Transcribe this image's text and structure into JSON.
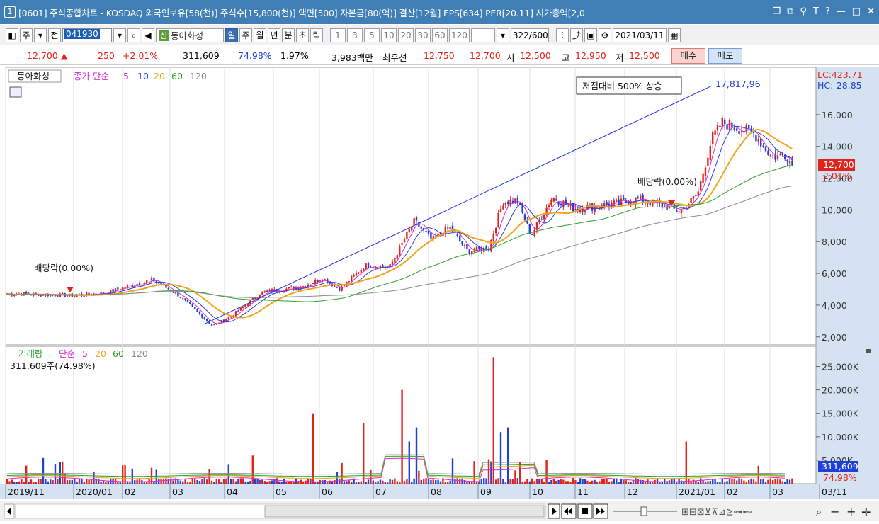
{
  "title": {
    "window_num": "1",
    "text": "[0601] 주식종합차트 - KOSDAQ 외국인보유[58(천)] 주식수[15,800(천)] 액면[500] 자본금[80(억)] 결산[12월] EPS[634] PER[20.11] 시가총액[2,0"
  },
  "toolbar": {
    "type_label": "주",
    "jeon_label": "전",
    "code": "041930",
    "stock_tag": "신",
    "stock_name": "동아화성",
    "periods": [
      "일",
      "주",
      "월",
      "년",
      "분",
      "초",
      "틱"
    ],
    "active_period": "일",
    "minute_opts": [
      "1",
      "3",
      "5",
      "10",
      "20",
      "30",
      "60",
      "120"
    ],
    "count": "322/600",
    "date": "2021/03/11"
  },
  "quote": {
    "price": "12,700 ▲",
    "change": "250",
    "rate": "+2.01%",
    "volume": "311,609",
    "vol_ratio": "74.98%",
    "turnover": "1.97%",
    "amount": "3,983백만",
    "best_label": "최우선",
    "ask": "12,750",
    "bid": "12,700",
    "open_label": "시",
    "open": "12,500",
    "high_label": "고",
    "high": "12,950",
    "low_label": "저",
    "low": "12,500",
    "buy": "매수",
    "sell": "매도"
  },
  "price_panel": {
    "stock_label": "동아화성",
    "ma_title": "종가 단순",
    "ma_periods": [
      "5",
      "10",
      "20",
      "60",
      "120"
    ],
    "annotation": "저점대비 500% 상승",
    "peak_label": "17,817,96",
    "lc_label": "LC:423.71",
    "hc_label": "HC:-28.85",
    "cur_price": "12,700",
    "cur_rate": "2.01%",
    "dividend_1": "배당락(0.00%)",
    "dividend_2": "배당락(0.00%)",
    "y_ticks": [
      "16,000",
      "14,000",
      "12,000",
      "10,000",
      "8,000",
      "6,000",
      "4,000",
      "2,000"
    ]
  },
  "volume_panel": {
    "title": "거래량",
    "ma_title": "단순",
    "ma_periods": [
      "5",
      "20",
      "60",
      "120"
    ],
    "info": "311,609주(74.98%)",
    "y_ticks": [
      "25,000K",
      "20,000K",
      "15,000K",
      "10,000K",
      "5,000K"
    ],
    "cur_vol": "311,609",
    "cur_ratio": "74.98%"
  },
  "x_axis": [
    "2019/11",
    "2020/01",
    "02",
    "03",
    "04",
    "05",
    "06",
    "07",
    "08",
    "09",
    "10",
    "11",
    "12",
    "2021/01",
    "02",
    "03",
    "03/11"
  ],
  "colors": {
    "up": "#e2231a",
    "down": "#1f3fd6",
    "ma5": "#d62bd0",
    "ma10": "#2b3fd6",
    "ma20": "#f2a31b",
    "ma60": "#2aa02a",
    "ma120": "#8a8a8a",
    "trend": "#2030e0"
  },
  "chart_data": {
    "type": "line",
    "title": "동아화성",
    "x": [
      "2019/11",
      "2020/01",
      "02",
      "03",
      "04",
      "05",
      "06",
      "07",
      "08",
      "09",
      "10",
      "11",
      "12",
      "2021/01",
      "02",
      "03"
    ],
    "series": [
      {
        "name": "종가",
        "values": [
          4700,
          4600,
          5200,
          2700,
          5000,
          5200,
          5400,
          6500,
          7800,
          10500,
          10300,
          10200,
          10500,
          15500,
          14500,
          12700
        ]
      }
    ],
    "ylim": [
      1500,
      18000
    ]
  }
}
